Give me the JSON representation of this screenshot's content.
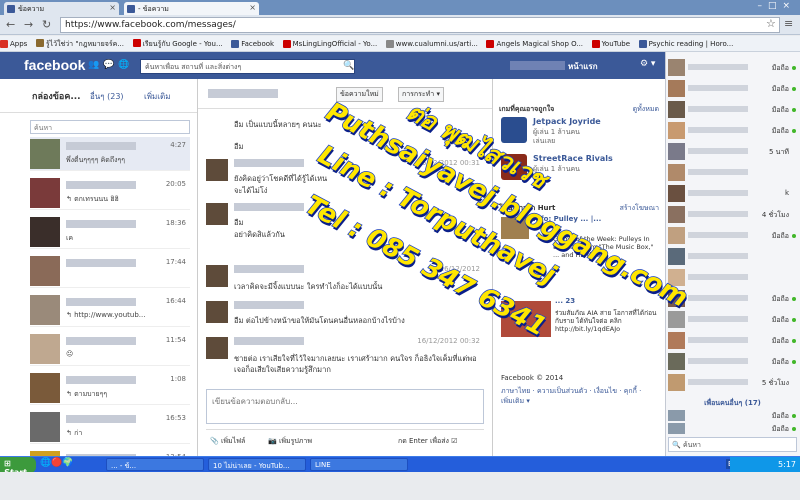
{
  "browser": {
    "tabs": [
      {
        "label": "ข้อความ"
      },
      {
        "label": "- ข้อความ"
      }
    ],
    "url": "https://www.facebook.com/messages/",
    "bookmarks": [
      {
        "label": "Apps",
        "color": "#d93025"
      },
      {
        "label": "รู้ไว้ใช่ว่า \"กฎหมายจร์ค...",
        "color": "#8a6a30"
      },
      {
        "label": "เรียนรู้กับ Google - You...",
        "color": "#cc0000"
      },
      {
        "label": "Facebook",
        "color": "#3b5998"
      },
      {
        "label": "MsLingLingOfficial - Yo...",
        "color": "#cc0000"
      },
      {
        "label": "www.cualumni.us/arti...",
        "color": "#888888"
      },
      {
        "label": "Angels Magical Shop O...",
        "color": "#cc0000"
      },
      {
        "label": "YouTube",
        "color": "#cc0000"
      },
      {
        "label": "Psychic reading | Horo...",
        "color": "#3b5998"
      }
    ]
  },
  "fb": {
    "logo": "facebook",
    "search_placeholder": "ค้นหาเพื่อน สถานที่ และสิ่งต่างๆ",
    "home": "หน้าแรก"
  },
  "inbox": {
    "title": "กล่องข้อค...",
    "other": "อื่นๆ (23)",
    "new_msg": "เพิ่มเติม",
    "search_placeholder": "ค้นหา",
    "conversations": [
      {
        "time": "4:27",
        "preview": "พึ่งตื่นๆๆๆๆ คิดถึงๆๆ"
      },
      {
        "time": "20:05",
        "preview": "↰ ตกเทรนนน ฮิฮิ"
      },
      {
        "time": "18:36",
        "preview": "เค"
      },
      {
        "time": "17:44",
        "preview": ""
      },
      {
        "time": "16:44",
        "preview": "↰ http://www.youtub..."
      },
      {
        "time": "11:54",
        "preview": "😐"
      },
      {
        "time": "1:08",
        "preview": "↰ ตามบายๆๆ"
      },
      {
        "time": "16:53",
        "preview": "↰ ก่า"
      },
      {
        "time": "13:54",
        "preview": "↰ ..."
      }
    ]
  },
  "thread": {
    "btn_new": "ข้อความใหม่",
    "btn_actions": "การกระทำ ▾",
    "messages": [
      {
        "time": "",
        "text": "อืม เป็นแบบนี้หลายๆ คนนะ"
      },
      {
        "time": "",
        "text": "อืม"
      },
      {
        "time": "16/12/2012 00:31",
        "text": "ยังคิดอยู่ว่าโชคดีที่ได้รู้ได้เหน"
      },
      {
        "time": "",
        "text": "จะได้ไม่โง่"
      },
      {
        "time": "",
        "text": "อืม"
      },
      {
        "time": "",
        "text": "อย่าคิดสิแล้วกัน"
      },
      {
        "time": "16/12/2012",
        "text": "เวลาคิดจะมีจิ้งแบบนะ ใครทำไงก็อะได้แบบนั้น"
      },
      {
        "time": "",
        "text": "อืม ต่อไปข้างหน้าขอให้มันโดนคนอื่นหลอกบ้างไรบ้าง"
      },
      {
        "time": "16/12/2012 00:32",
        "text": "ชายต่อ เราเสียใจที่ไว้ใจมากเลยนะ เราเศร้ามาก คนใจร ก็อธิงใจเค็มที่แต่พอเจอก็อเสียใจเสียความรู้สึกมาก"
      }
    ],
    "reply_placeholder": "เขียนข้อความตอบกลับ...",
    "attach": "เพิ่มไฟล์",
    "photo": "เพิ่มรูปภาพ",
    "enter_send": "กด Enter เพื่อส่ง"
  },
  "sidebar": {
    "games_header": "เกมที่คุณอาจถูกใจ",
    "see_all": "ดูทั้งหมด",
    "games": [
      {
        "title": "Jetpack Joyride",
        "sub": "ผู้เล่น 1 ล้านคน",
        "action": "เล่นเลย",
        "color": "#2a4d8f"
      },
      {
        "title": "StreetRace Rivals",
        "sub": "ผู้เล่น 1 ล้านคน",
        "action": "",
        "color": "#8a2a1a"
      }
    ],
    "sponsored_header": "โฆษณาจาก Hurt",
    "create_ad": "สร้างโฆษณา",
    "ad1_title": "Info: Pulley ... |...",
    "ad1_text": "Gizmo of the Week: Pulleys In the 1932 film \"The Music Box,\" ... and Hardy are",
    "ad2_title": "... 23",
    "ad2_text": "ร่วมสัมภัณ AIA สาย โอกาสที่ได้ก่อนกับราย ได้ทันใจต่อ คลิก http://bit.ly/1qdEAJo",
    "footer": "Facebook © 2014",
    "footer_links": "ภาษาไทย · ความเป็นส่วนตัว · เงื่อนไข · คุกกี้ · เพิ่มเติม ▾"
  },
  "chat": {
    "rows": [
      {
        "status": "มือถือ",
        "online": true
      },
      {
        "status": "มือถือ",
        "online": true
      },
      {
        "status": "มือถือ",
        "online": true
      },
      {
        "status": "มือถือ",
        "online": true
      },
      {
        "status": "5 นาที",
        "online": false
      },
      {
        "status": "",
        "online": false
      },
      {
        "status": "k",
        "online": false
      },
      {
        "status": "4 ชั่วโมง",
        "online": false
      },
      {
        "status": "มือถือ",
        "online": true
      },
      {
        "status": "",
        "online": false
      },
      {
        "status": "",
        "online": false
      },
      {
        "status": "มือถือ",
        "online": true
      },
      {
        "status": "มือถือ",
        "online": true
      },
      {
        "status": "มือถือ",
        "online": true
      },
      {
        "status": "มือถือ",
        "online": true
      },
      {
        "status": "5 ชั่วโมง",
        "online": false
      }
    ],
    "friends_header": "เพื่อนคนอื่นๆ (17)",
    "bottom_rows": [
      {
        "status": "มือถือ",
        "online": true
      },
      {
        "status": "มือถือ",
        "online": true
      }
    ],
    "search_placeholder": "ค้นหา"
  },
  "taskbar": {
    "start": "Start",
    "items": [
      {
        "label": "... - ข้..."
      },
      {
        "label": "10 ไม่น่าเลย - YouTub..."
      },
      {
        "label": "LINE"
      }
    ],
    "lang": "EN",
    "clock": "5:17"
  },
  "watermark": {
    "line1": "ต่อ พุฒไสวเวช",
    "line2": "Puthsaiyavej.bloggang.com",
    "line3": "Line : Torputhavej",
    "line4": "Tel : 085 347 6341"
  }
}
